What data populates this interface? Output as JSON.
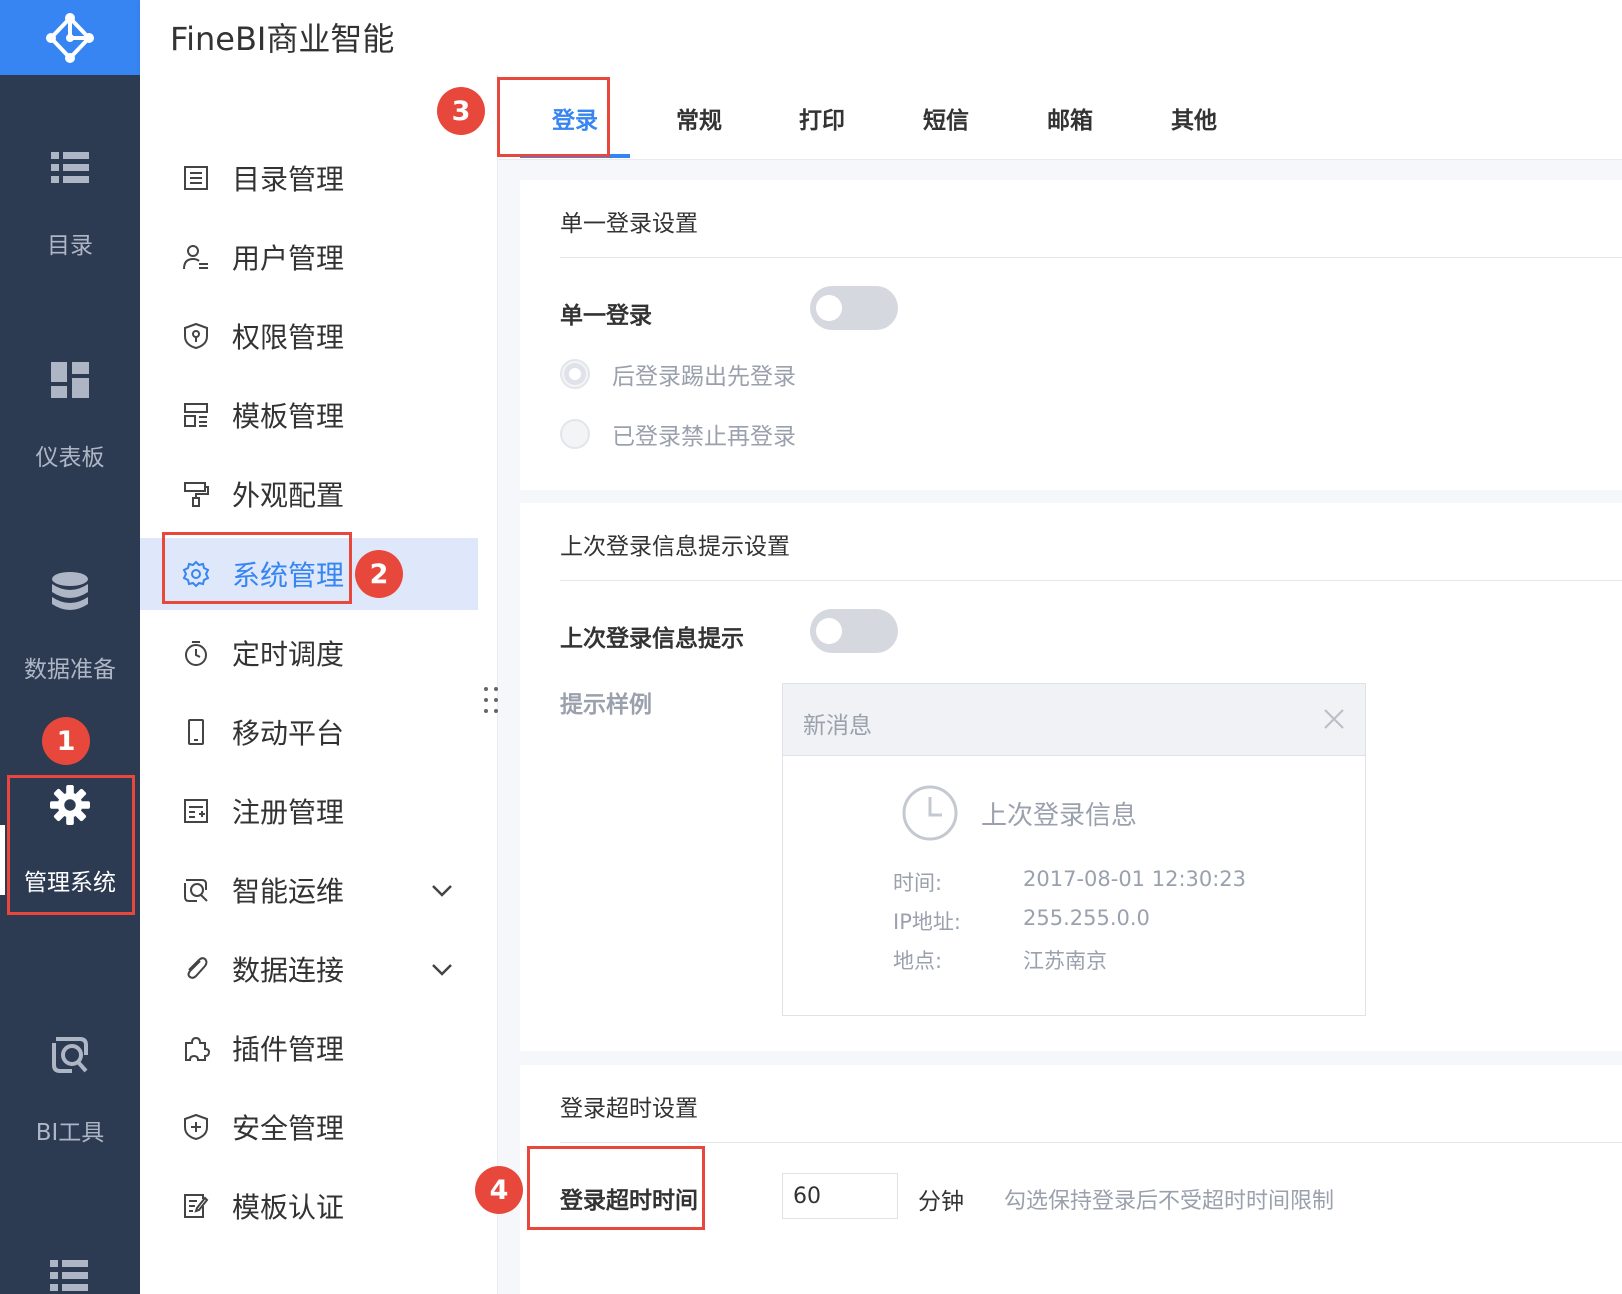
{
  "app": {
    "title": "FineBI商业智能"
  },
  "rail": {
    "items": [
      {
        "label": "目录",
        "icon": "list-icon"
      },
      {
        "label": "仪表板",
        "icon": "dashboard-icon"
      },
      {
        "label": "数据准备",
        "icon": "database-icon"
      },
      {
        "label": "管理系统",
        "icon": "gear-icon",
        "active": true
      },
      {
        "label": "BI工具",
        "icon": "bi-tool-icon"
      }
    ]
  },
  "sidebar": {
    "items": [
      {
        "label": "目录管理",
        "icon": "catalog-icon"
      },
      {
        "label": "用户管理",
        "icon": "user-icon"
      },
      {
        "label": "权限管理",
        "icon": "permission-icon"
      },
      {
        "label": "模板管理",
        "icon": "template-icon"
      },
      {
        "label": "外观配置",
        "icon": "paint-roller-icon"
      },
      {
        "label": "系统管理",
        "icon": "gear-icon",
        "active": true
      },
      {
        "label": "定时调度",
        "icon": "timer-icon"
      },
      {
        "label": "移动平台",
        "icon": "mobile-icon"
      },
      {
        "label": "注册管理",
        "icon": "register-icon"
      },
      {
        "label": "智能运维",
        "icon": "ops-icon",
        "expandable": true
      },
      {
        "label": "数据连接",
        "icon": "paperclip-icon",
        "expandable": true
      },
      {
        "label": "插件管理",
        "icon": "puzzle-icon"
      },
      {
        "label": "安全管理",
        "icon": "shield-plus-icon"
      },
      {
        "label": "模板认证",
        "icon": "certify-icon"
      }
    ]
  },
  "tabs": [
    {
      "label": "登录",
      "active": true
    },
    {
      "label": "常规"
    },
    {
      "label": "打印"
    },
    {
      "label": "短信"
    },
    {
      "label": "邮箱"
    },
    {
      "label": "其他"
    }
  ],
  "sso": {
    "section_title": "单一登录设置",
    "toggle_label": "单一登录",
    "toggle_on": false,
    "options": [
      "后登录踢出先登录",
      "已登录禁止再登录"
    ]
  },
  "last_login": {
    "section_title": "上次登录信息提示设置",
    "toggle_label": "上次登录信息提示",
    "toggle_on": false,
    "sample_label": "提示样例",
    "sample": {
      "header": "新消息",
      "title": "上次登录信息",
      "rows": [
        {
          "key": "时间:",
          "value": "2017-08-01 12:30:23"
        },
        {
          "key": "IP地址:",
          "value": "255.255.0.0"
        },
        {
          "key": "地点:",
          "value": "江苏南京"
        }
      ]
    }
  },
  "timeout": {
    "section_title": "登录超时设置",
    "label": "登录超时时间",
    "value": "60",
    "unit": "分钟",
    "hint": "勾选保持登录后不受超时时间限制"
  },
  "annotations": [
    "1",
    "2",
    "3",
    "4"
  ],
  "colors": {
    "accent": "#3685f2",
    "rail": "#2c3a52",
    "highlight": "#e8483b"
  }
}
